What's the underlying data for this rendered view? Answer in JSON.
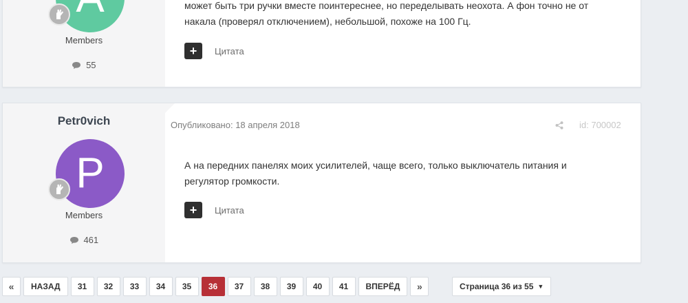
{
  "posts": [
    {
      "avatar_letter": "A",
      "avatar_color": "#5fcaa0",
      "group": "Members",
      "post_count": "55",
      "text_lines": [
        "может быть три ручки вместе поинтереснее, но переделывать неохота. А фон точно не от",
        "накала (проверял отключением), небольшой, похоже на 100 Гц."
      ],
      "quote_label": "Цитата"
    },
    {
      "username": "Petr0vich",
      "avatar_letter": "P",
      "avatar_color": "#8b5ac7",
      "group": "Members",
      "post_count": "461",
      "published": "Опубликовано: 18 апреля 2018",
      "post_id": "id: 700002",
      "text_lines": [
        "А на передних панелях моих усилителей, чаще всего, только выключатель питания и",
        "регулятор громкости."
      ],
      "quote_label": "Цитата"
    }
  ],
  "pagination": {
    "first": "«",
    "prev": "НАЗАД",
    "pages": [
      "31",
      "32",
      "33",
      "34",
      "35",
      "36",
      "37",
      "38",
      "39",
      "40",
      "41"
    ],
    "current": "36",
    "next": "ВПЕРЁД",
    "last": "»",
    "page_info": "Страница 36 из 55",
    "accent_color": "#b73037"
  }
}
